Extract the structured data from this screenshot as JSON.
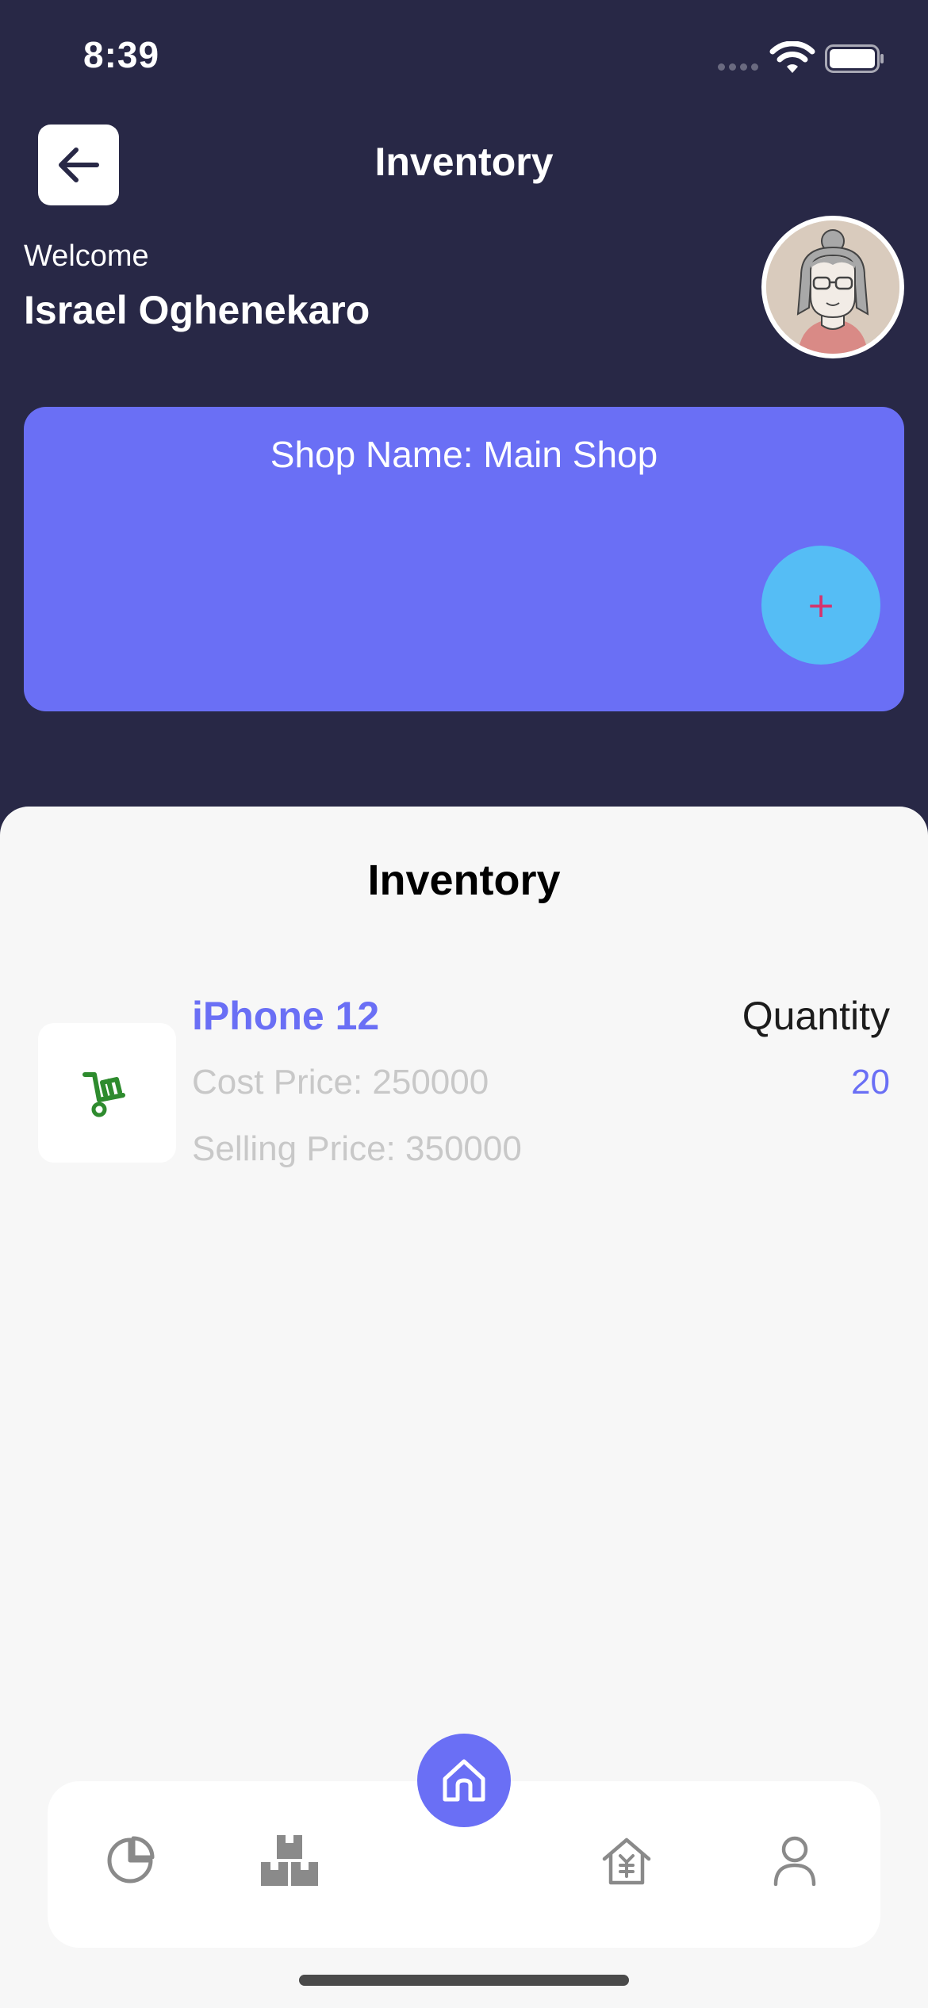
{
  "status_bar": {
    "time": "8:39",
    "icons": [
      "signal-icon",
      "wifi-icon",
      "battery-icon"
    ]
  },
  "header": {
    "title": "Inventory",
    "back_icon": "arrow-left-icon"
  },
  "user": {
    "welcome": "Welcome",
    "name": "Israel Oghenekaro"
  },
  "shop": {
    "label": "Shop Name: Main Shop",
    "add_symbol": "+"
  },
  "inventory": {
    "title": "Inventory",
    "items": [
      {
        "name": "iPhone 12",
        "cost": "Cost Price: 250000",
        "selling": "Selling Price: 350000",
        "quantity_label": "Quantity",
        "quantity": "20",
        "icon": "cart-icon"
      }
    ]
  },
  "bottom_nav": {
    "items": [
      "pie-chart-icon",
      "boxes-icon",
      "home-icon",
      "store-icon",
      "profile-icon"
    ],
    "active": "home-icon"
  },
  "colors": {
    "header_bg": "#282846",
    "accent": "#6a6ff5",
    "fab": "#55bdf5",
    "sheet_bg": "#f7f7f7",
    "cart_green": "#2e8b2e"
  }
}
